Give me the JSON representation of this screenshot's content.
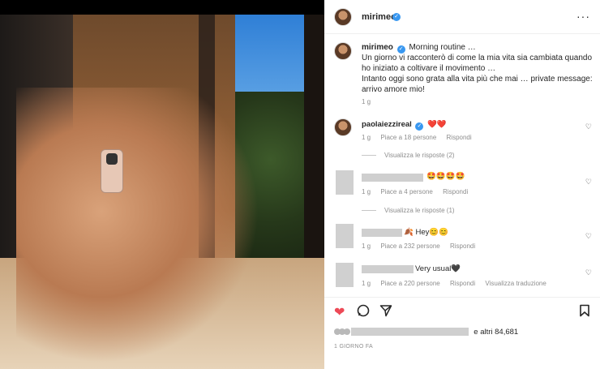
{
  "post": {
    "author": "mirimeo",
    "caption_lines": [
      "Morning routine …",
      "Un giorno vi racconterò di come la mia vita sia cambiata quando",
      "ho iniziato a coltivare il movimento …",
      "Intanto oggi sono grata alla vita più che mai … private message:",
      "arrivo amore mio!"
    ],
    "caption_time": "1 g",
    "more_icon": "···"
  },
  "comments": [
    {
      "user": "paolaiezzireal",
      "text": "❤️❤️",
      "time": "1 g",
      "likes": "Piace a 18 persone",
      "reply": "Rispondi",
      "view_replies": "Visualizza le risposte (2)"
    },
    {
      "user": "",
      "text": "🤩🤩🤩🤩",
      "time": "1 g",
      "likes": "Piace a 4 persone",
      "reply": "Rispondi",
      "view_replies": "Visualizza le risposte (1)"
    },
    {
      "user": "",
      "text": "🍂 Hey😊😊",
      "time": "1 g",
      "likes": "Piace a 232 persone",
      "reply": "Rispondi"
    },
    {
      "user": "",
      "text": "Very usual🖤",
      "time": "1 g",
      "likes": "Piace a 220 persone",
      "reply": "Rispondi",
      "translate": "Visualizza traduzione"
    }
  ],
  "likes_summary": "e altri 84,681",
  "date_label": "1 GIORNO FA",
  "icons": {
    "like": "heart-icon",
    "comment": "comment-icon",
    "share": "share-icon",
    "save": "bookmark-icon"
  },
  "colors": {
    "like_red": "#ed4956",
    "verified_blue": "#3897f0"
  }
}
